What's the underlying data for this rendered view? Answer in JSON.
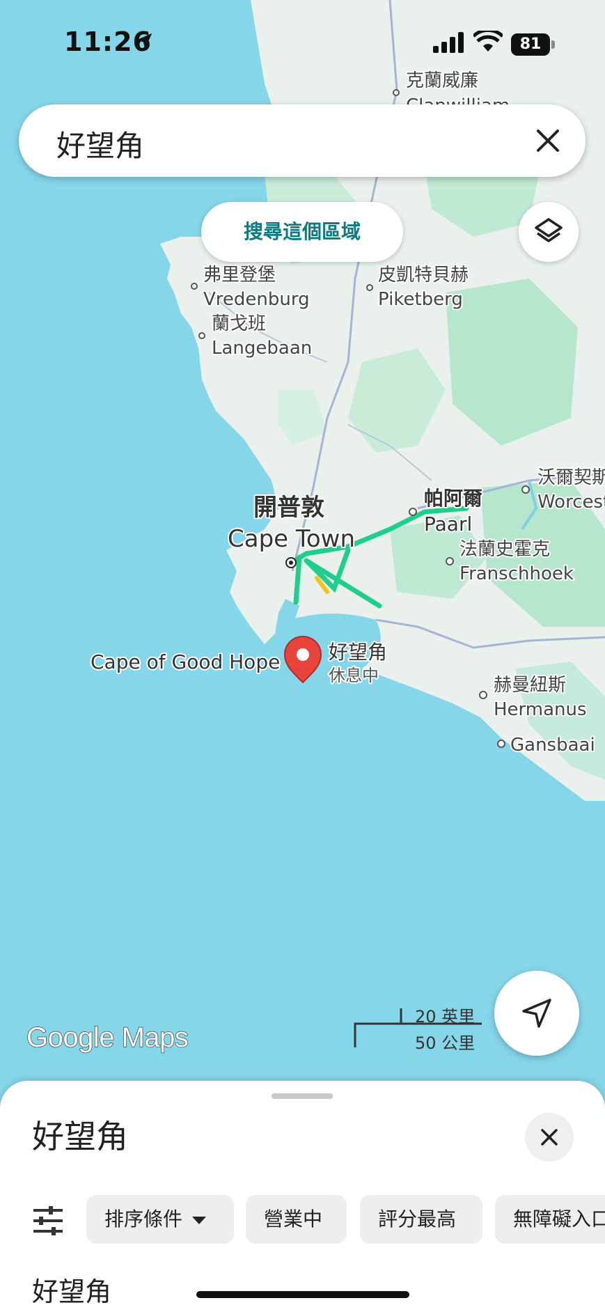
{
  "status_bar": {
    "time": "11:26",
    "battery": "81"
  },
  "search": {
    "query": "好望角"
  },
  "map": {
    "search_area_label": "搜尋這個區域",
    "labels": {
      "clanwilliam_zh": "克蘭威廉",
      "clanwilliam_en": "Clanwilliam",
      "vredenburg_zh": "弗里登堡",
      "vredenburg_en": "Vredenburg",
      "langebaan_zh": "蘭戈班",
      "langebaan_en": "Langebaan",
      "piketberg_zh": "皮凱特貝赫",
      "piketberg_en": "Piketberg",
      "worcester_zh": "沃爾契斯",
      "worcester_en": "Worcest",
      "paarl_zh": "帕阿爾",
      "paarl_en": "Paarl",
      "capetown_zh": "開普敦",
      "capetown_en": "Cape Town",
      "franschhoek_zh": "法蘭史霍克",
      "franschhoek_en": "Franschhoek",
      "cape_en": "Cape of Good Hope",
      "cape_zh": "好望角",
      "cape_status": "休息中",
      "hermanus_zh": "赫曼紐斯",
      "hermanus_en": "Hermanus",
      "gansbaai_en": "Gansbaai"
    },
    "logo": "Google Maps",
    "scale": {
      "miles": "20 英里",
      "km": "50 公里"
    },
    "colors": {
      "water": "#86d6ea",
      "land": "#eaf1ec",
      "green": "#bfe9d2",
      "route": "#1ecf8c",
      "pin": "#e8443a"
    }
  },
  "sheet": {
    "title": "好望角",
    "filters": [
      "排序條件",
      "營業中",
      "評分最高",
      "無障礙入口"
    ],
    "first_result": "好望角"
  },
  "icons": [
    "location-arrow-icon",
    "signal-icon",
    "wifi-icon",
    "close-icon",
    "layers-icon",
    "navigate-icon",
    "filter-sliders-icon",
    "map-pin-icon"
  ]
}
